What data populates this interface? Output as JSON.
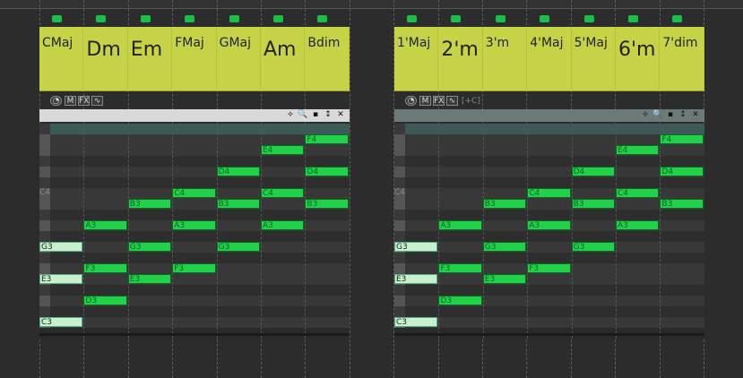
{
  "panels": [
    {
      "id": "left",
      "chords": [
        {
          "label": "CMaj",
          "size": "small"
        },
        {
          "label": "Dm",
          "size": "big"
        },
        {
          "label": "Em",
          "size": "big"
        },
        {
          "label": "FMaj",
          "size": "small"
        },
        {
          "label": "GMaj",
          "size": "small"
        },
        {
          "label": "Am",
          "size": "big"
        },
        {
          "label": "Bdim",
          "size": "small"
        }
      ],
      "toolbar": {
        "m": "M",
        "fx": "FX",
        "extra": ""
      },
      "c4_label": "C4",
      "notes": [
        [
          "C3",
          0
        ],
        [
          "E3",
          0
        ],
        [
          "G3",
          0
        ],
        [
          "D3",
          1
        ],
        [
          "F3",
          1
        ],
        [
          "A3",
          1
        ],
        [
          "E3",
          2
        ],
        [
          "G3",
          2
        ],
        [
          "B3",
          2
        ],
        [
          "F3",
          3
        ],
        [
          "A3",
          3
        ],
        [
          "C4",
          3
        ],
        [
          "G3",
          4
        ],
        [
          "B3",
          4
        ],
        [
          "D4",
          4
        ],
        [
          "A3",
          5
        ],
        [
          "C4",
          5
        ],
        [
          "E4",
          5
        ],
        [
          "B3",
          6
        ],
        [
          "D4",
          6
        ],
        [
          "F4",
          6
        ]
      ]
    },
    {
      "id": "right",
      "chords": [
        {
          "label": "1'Maj",
          "size": "small"
        },
        {
          "label": "2'm",
          "size": "big"
        },
        {
          "label": "3'm",
          "size": "small"
        },
        {
          "label": "4'Maj",
          "size": "small"
        },
        {
          "label": "5'Maj",
          "size": "small"
        },
        {
          "label": "6'm",
          "size": "big"
        },
        {
          "label": "7'dim",
          "size": "small"
        }
      ],
      "toolbar": {
        "m": "M",
        "fx": "FX",
        "extra": "[+C]"
      },
      "c4_label": "C4",
      "notes": [
        [
          "C3",
          0
        ],
        [
          "E3",
          0
        ],
        [
          "G3",
          0
        ],
        [
          "D3",
          1
        ],
        [
          "F3",
          1
        ],
        [
          "A3",
          1
        ],
        [
          "E3",
          2
        ],
        [
          "G3",
          2
        ],
        [
          "B3",
          2
        ],
        [
          "F3",
          3
        ],
        [
          "A3",
          3
        ],
        [
          "C4",
          3
        ],
        [
          "G3",
          4
        ],
        [
          "B3",
          4
        ],
        [
          "D4",
          4
        ],
        [
          "A3",
          5
        ],
        [
          "C4",
          5
        ],
        [
          "E4",
          5
        ],
        [
          "B3",
          6
        ],
        [
          "D4",
          6
        ],
        [
          "F4",
          6
        ]
      ]
    }
  ],
  "colors": {
    "note": "#22d04a",
    "pale_note": "#c8f0cc",
    "chord_bg": "#c7d346"
  }
}
